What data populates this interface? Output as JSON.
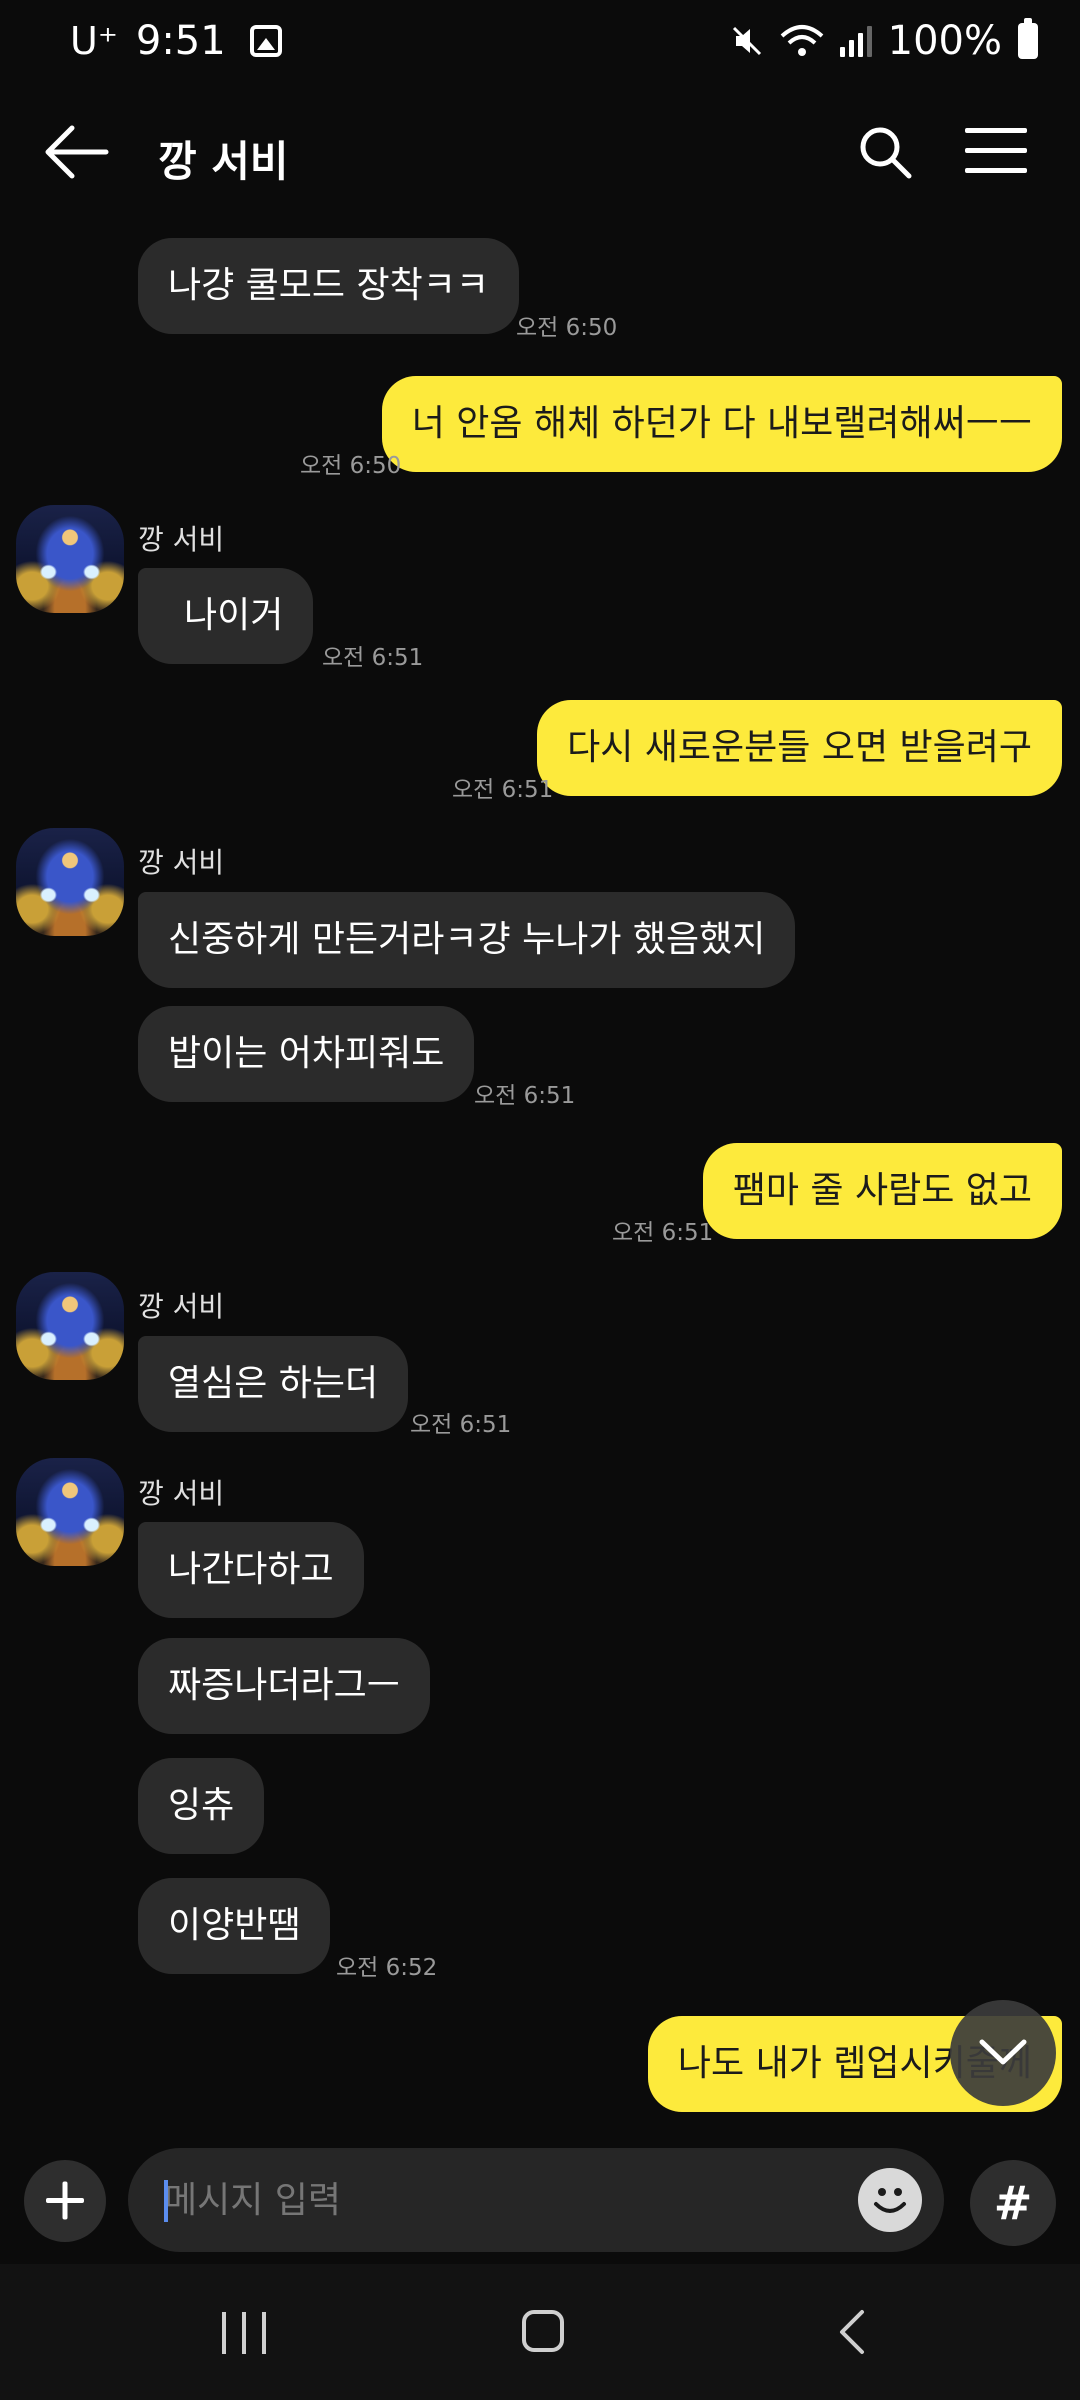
{
  "status_bar": {
    "carrier": "U⁺",
    "time": "9:51",
    "battery": "100%",
    "icons": [
      "gallery-icon",
      "mute-icon",
      "wifi-icon",
      "signal-icon",
      "battery-icon"
    ]
  },
  "header": {
    "title": "깡 서비",
    "icons": [
      "back-arrow-icon",
      "search-icon",
      "menu-icon"
    ]
  },
  "messages": [
    {
      "side": "in",
      "text": "나걍 쿨모드 장착ㅋㅋ",
      "time": "오전 6:50"
    },
    {
      "side": "out",
      "text": "너 안옴 해체 하던가 다 내보랠려해써ㅡㅡ",
      "time": "오전 6:50"
    },
    {
      "side": "in",
      "sender": "깡 서비",
      "text": "나이거",
      "time": "오전 6:51"
    },
    {
      "side": "out",
      "text": "다시 새로운분들 오면 받을려구",
      "time": "오전 6:51"
    },
    {
      "side": "in",
      "sender": "깡 서비",
      "text": "신중하게 만든거라ㅋ걍 누나가 했음했지"
    },
    {
      "side": "in",
      "text": "밥이는 어차피줘도",
      "time": "오전 6:51"
    },
    {
      "side": "out",
      "text": "팸마 줄 사람도 없고",
      "time": "오전 6:51"
    },
    {
      "side": "in",
      "sender": "깡 서비",
      "text": "열심은 하는더",
      "time": "오전 6:51"
    },
    {
      "side": "in",
      "sender": "깡 서비",
      "text": "나간다하고"
    },
    {
      "side": "in",
      "text": "짜증나더라그ㅡ"
    },
    {
      "side": "in",
      "text": "잉츄"
    },
    {
      "side": "in",
      "text": "이양반땜",
      "time": "오전 6:52"
    },
    {
      "side": "out",
      "text": "나도 내가 렙업시키줄께"
    }
  ],
  "input": {
    "placeholder": "메시지 입력",
    "hash_label": "#",
    "icons": [
      "plus-icon",
      "emoji-icon",
      "hash-icon",
      "chevron-down-icon"
    ]
  },
  "colors": {
    "background": "#0b0b0b",
    "incoming_bubble": "#2b2b2b",
    "outgoing_bubble": "#fdea3c"
  }
}
